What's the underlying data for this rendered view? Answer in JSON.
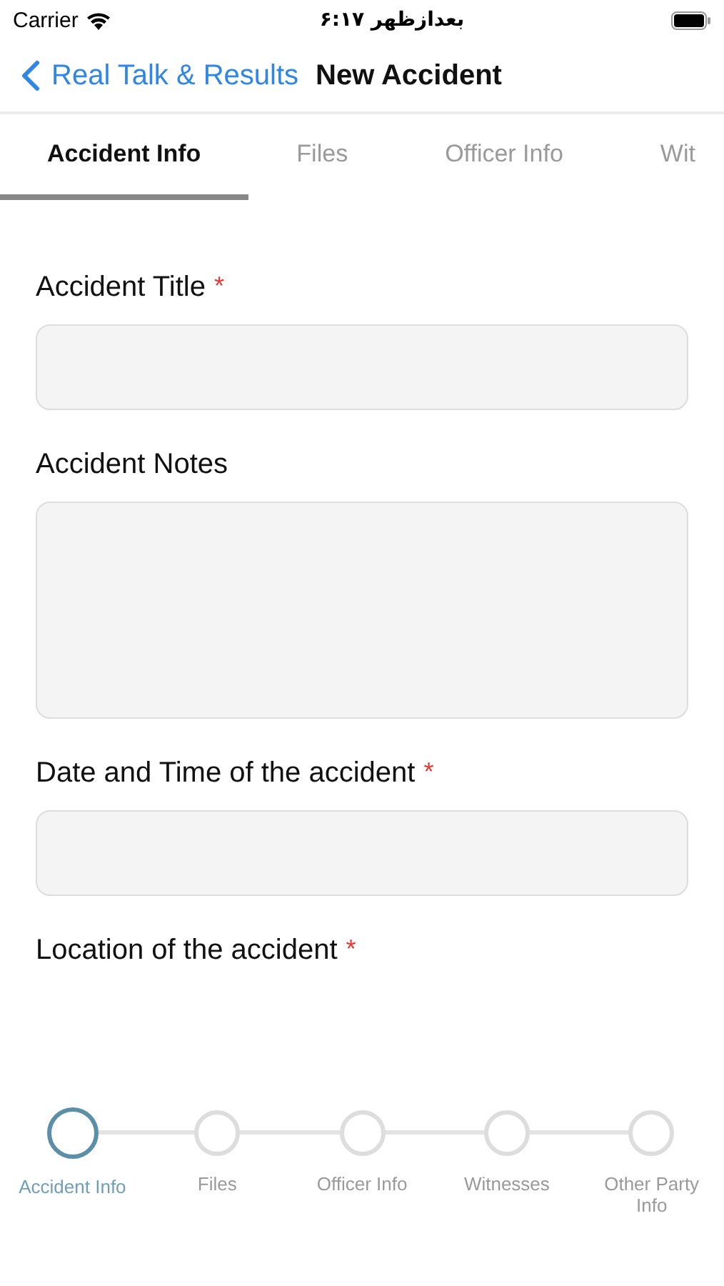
{
  "status_bar": {
    "carrier": "Carrier",
    "time": "بعدازظهر ۶:۱۷"
  },
  "nav": {
    "back_label": "Real Talk & Results",
    "title": "New Accident"
  },
  "tabs": [
    {
      "label": "Accident Info",
      "selected": true
    },
    {
      "label": "Files",
      "selected": false
    },
    {
      "label": "Officer Info",
      "selected": false
    },
    {
      "label": "Wit",
      "selected": false
    }
  ],
  "fields": [
    {
      "label": "Accident Title",
      "required": true,
      "kind": "text-field"
    },
    {
      "label": "Accident Notes",
      "required": false,
      "kind": "text-area"
    },
    {
      "label": "Date and Time of the accident",
      "required": true,
      "kind": "text-field"
    },
    {
      "label": "Location of the accident",
      "required": true,
      "kind": "label-only"
    }
  ],
  "required_mark": "*",
  "steps": [
    {
      "label": "Accident Info",
      "selected": true
    },
    {
      "label": "Files",
      "selected": false
    },
    {
      "label": "Officer Info",
      "selected": false
    },
    {
      "label": "Witnesses",
      "selected": false
    },
    {
      "label": "Other Party Info",
      "selected": false
    }
  ]
}
